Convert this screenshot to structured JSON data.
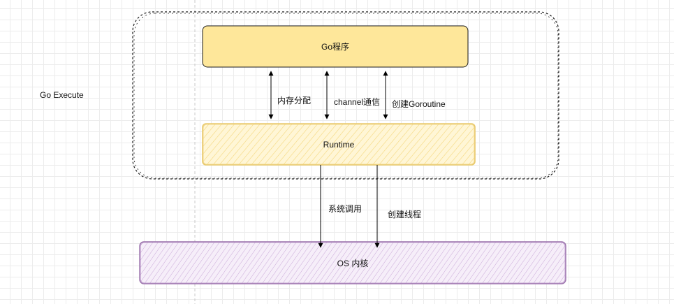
{
  "container_label": "Go Execute",
  "boxes": {
    "program": {
      "label": "Go程序",
      "fill": "#fee79a",
      "stroke": "#1a1a1a"
    },
    "runtime": {
      "label": "Runtime",
      "fill": "#fff2c2",
      "stroke": "#e8c86a"
    },
    "kernel": {
      "label": "OS 内核",
      "fill": "#e7d7ee",
      "stroke": "#9b72ac"
    }
  },
  "edges": {
    "memory_alloc": "内存分配",
    "channel_comm": "channel通信",
    "create_goroutine": "创建Goroutine",
    "syscall": "系统调用",
    "create_thread": "创建线程"
  },
  "colors": {
    "grid": "#ececec",
    "arrow": "#000000",
    "dashed": "#1a1a1a"
  }
}
